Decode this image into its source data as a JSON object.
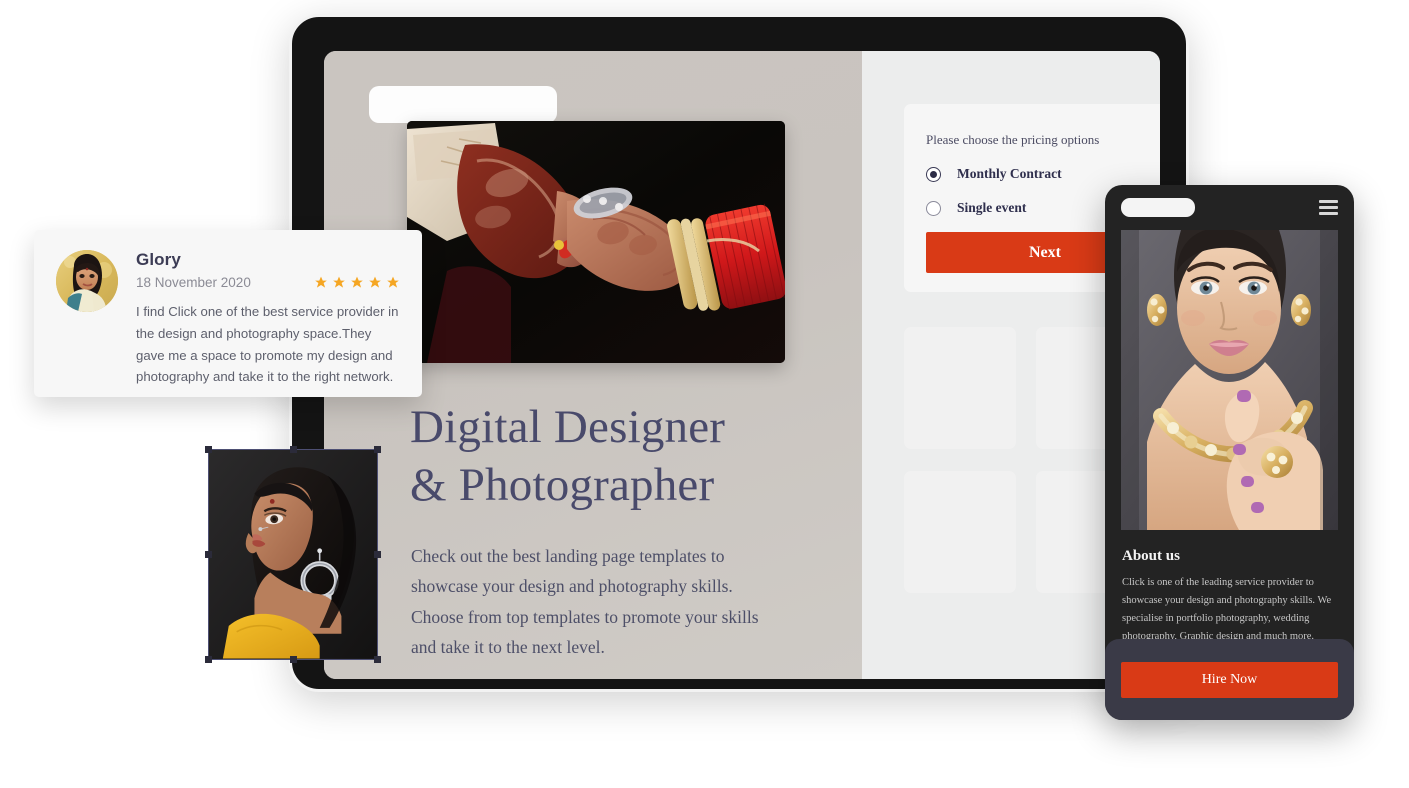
{
  "colors": {
    "accent_orange": "#d93a16",
    "heading_navy": "#494a6b",
    "star_amber": "#f5a623",
    "phone_body_dark": "#232323",
    "phone_footer_slate": "#3a3a47",
    "tablet_canvas_warm_grey": "#cac5c0",
    "tablet_panel_grey": "#eceded"
  },
  "tablet": {
    "logo_placeholder": "",
    "hero_image_alt": "wedding-hands-henna-photo",
    "hero": {
      "title_line1": "Digital Designer",
      "title_line2": "& Photographer",
      "body": "Check out the best landing page templates to showcase your design and photography skills. Choose from top templates to promote your skills and take it to the next level."
    },
    "pricing": {
      "prompt": "Please choose the pricing options",
      "options": [
        {
          "label": "Monthly Contract",
          "selected": true
        },
        {
          "label": "Single event",
          "selected": false
        }
      ],
      "next_label": "Next"
    },
    "gallery": {
      "cards": [
        "",
        "",
        "",
        ""
      ]
    }
  },
  "selected_image": {
    "alt": "portrait-woman-earring-photo",
    "selected": true,
    "handle_count": 8
  },
  "testimonial": {
    "avatar_alt": "glory-avatar",
    "name": "Glory",
    "date": "18 November 2020",
    "rating": 5,
    "rating_max": 5,
    "text": "I find Click one of the best service provider in the design and photography space.They gave me a space to promote my design and photography and take it to the right network."
  },
  "phone": {
    "logo_placeholder": "",
    "menu_icon": "hamburger-menu-icon",
    "photo_alt": "jewellery-model-portrait-photo",
    "about": {
      "title": "About us",
      "text": "Click is one of the leading service provider to showcase your design and photography skills. We specialise in portfolio photography, wedding photography, Graphic design and much more."
    },
    "cta_label": "Hire Now"
  }
}
